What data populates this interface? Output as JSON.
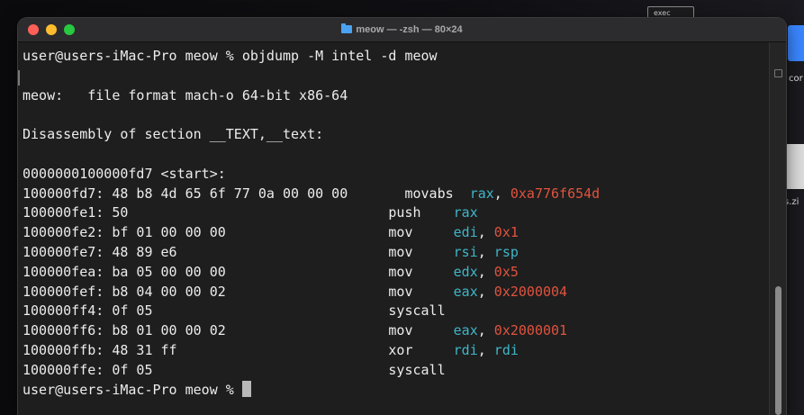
{
  "desktop": {
    "exec_chip": "exec",
    "label_top": "cor",
    "label_zip": "s.zi"
  },
  "window": {
    "title": "meow — -zsh — 80×24"
  },
  "terminal": {
    "lines": [
      [
        {
          "t": "user@users-iMac-Pro meow % objdump -M intel -d meow"
        }
      ],
      [],
      [
        {
          "t": "meow:   file format mach-o 64-bit x86-64"
        }
      ],
      [],
      [
        {
          "t": "Disassembly of section __TEXT,__text:"
        }
      ],
      [],
      [
        {
          "t": "0000000100000fd7 <start>:"
        }
      ],
      [
        {
          "t": "100000fd7: 48 b8 4d 65 6f 77 0a 00 00 00       movabs  "
        },
        {
          "t": "rax",
          "c": "reg"
        },
        {
          "t": ", "
        },
        {
          "t": "0xa776f654d",
          "c": "num"
        }
      ],
      [
        {
          "t": "100000fe1: 50                                push    "
        },
        {
          "t": "rax",
          "c": "reg"
        }
      ],
      [
        {
          "t": "100000fe2: bf 01 00 00 00                    mov     "
        },
        {
          "t": "edi",
          "c": "reg"
        },
        {
          "t": ", "
        },
        {
          "t": "0x1",
          "c": "num"
        }
      ],
      [
        {
          "t": "100000fe7: 48 89 e6                          mov     "
        },
        {
          "t": "rsi",
          "c": "reg"
        },
        {
          "t": ", "
        },
        {
          "t": "rsp",
          "c": "reg"
        }
      ],
      [
        {
          "t": "100000fea: ba 05 00 00 00                    mov     "
        },
        {
          "t": "edx",
          "c": "reg"
        },
        {
          "t": ", "
        },
        {
          "t": "0x5",
          "c": "num"
        }
      ],
      [
        {
          "t": "100000fef: b8 04 00 00 02                    mov     "
        },
        {
          "t": "eax",
          "c": "reg"
        },
        {
          "t": ", "
        },
        {
          "t": "0x2000004",
          "c": "num"
        }
      ],
      [
        {
          "t": "100000ff4: 0f 05                             syscall"
        }
      ],
      [
        {
          "t": "100000ff6: b8 01 00 00 02                    mov     "
        },
        {
          "t": "eax",
          "c": "reg"
        },
        {
          "t": ", "
        },
        {
          "t": "0x2000001",
          "c": "num"
        }
      ],
      [
        {
          "t": "100000ffb: 48 31 ff                          xor     "
        },
        {
          "t": "rdi",
          "c": "reg"
        },
        {
          "t": ", "
        },
        {
          "t": "rdi",
          "c": "reg"
        }
      ],
      [
        {
          "t": "100000ffe: 0f 05                             syscall"
        }
      ],
      [
        {
          "t": "user@users-iMac-Pro meow % "
        },
        {
          "cursor": true
        }
      ]
    ]
  },
  "colors": {
    "register": "#3fb6c8",
    "immediate": "#e0533f",
    "text": "#ececec",
    "background": "#1e1e1e"
  }
}
